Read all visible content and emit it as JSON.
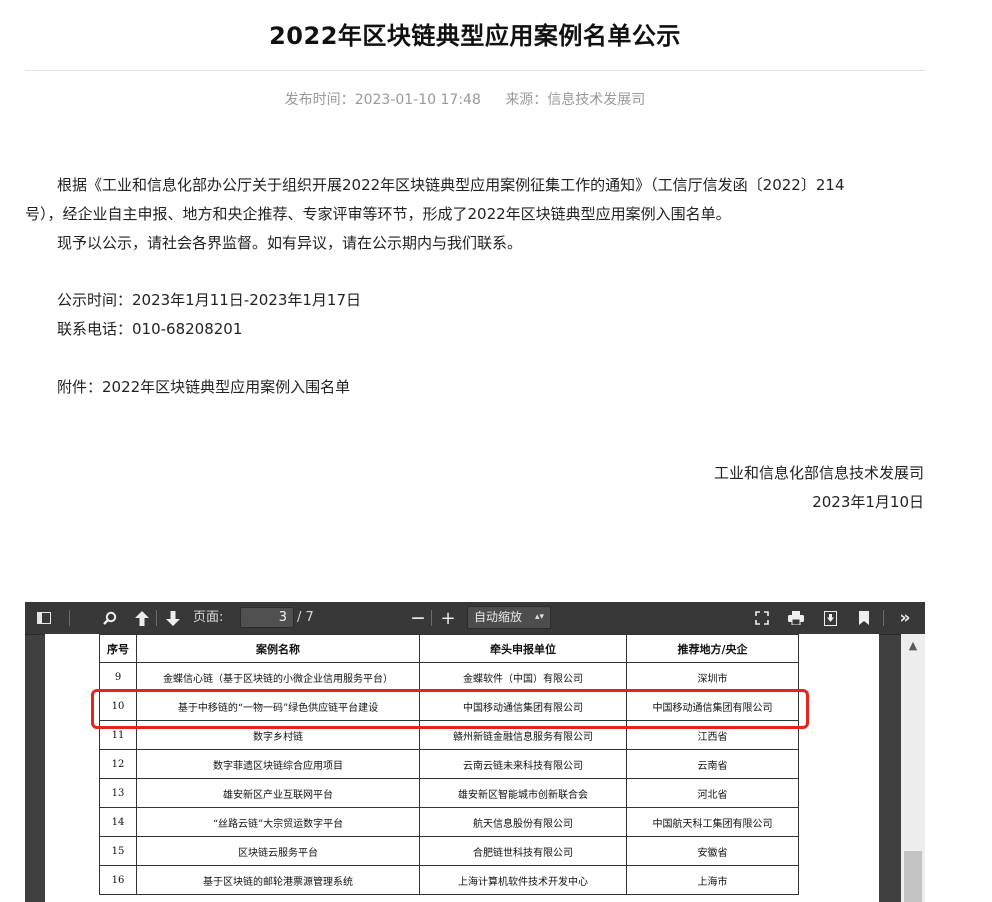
{
  "article": {
    "title": "2022年区块链典型应用案例名单公示",
    "publish_label": "发布时间：",
    "publish_time": "2023-01-10 17:48",
    "source_label": "来源：",
    "source": "信息技术发展司",
    "body_line1": "根据《工业和信息化部办公厅关于组织开展2022年区块链典型应用案例征集工作的通知》（工信厅信发函〔2022〕214",
    "body_line2": "号），经企业自主申报、地方和央企推荐、专家评审等环节，形成了2022年区块链典型应用案例入围名单。",
    "body_line3": "现予以公示，请社会各界监督。如有异议，请在公示期内与我们联系。",
    "period": "公示时间：2023年1月11日-2023年1月17日",
    "phone": "联系电话：010-68208201",
    "attachment": "附件：2022年区块链典型应用案例入围名单",
    "signature_org": "工业和信息化部信息技术发展司",
    "signature_date": "2023年1月10日"
  },
  "viewer": {
    "page_label": "页面:",
    "page_current": "3",
    "page_total": "/ 7",
    "zoom": "自动缩放",
    "zoom_out": "—",
    "zoom_in": "+"
  },
  "table": {
    "headers": [
      "序号",
      "案例名称",
      "牵头申报单位",
      "推荐地方/央企"
    ],
    "rows": [
      [
        "9",
        "金蝶信心链（基于区块链的小微企业信用服务平台）",
        "金蝶软件（中国）有限公司",
        "深圳市"
      ],
      [
        "10",
        "基于中移链的“一物一码”绿色供应链平台建设",
        "中国移动通信集团有限公司",
        "中国移动通信集团有限公司"
      ],
      [
        "11",
        "数字乡村链",
        "赣州新链金融信息服务有限公司",
        "江西省"
      ],
      [
        "12",
        "数字菲遗区块链综合应用项目",
        "云南云链未来科技有限公司",
        "云南省"
      ],
      [
        "13",
        "雄安新区产业互联网平台",
        "雄安新区智能城市创新联合会",
        "河北省"
      ],
      [
        "14",
        "“丝路云链”大宗贸运数字平台",
        "航天信息股份有限公司",
        "中国航天科工集团有限公司"
      ],
      [
        "15",
        "区块链云服务平台",
        "合肥链世科技有限公司",
        "安徽省"
      ],
      [
        "16",
        "基于区块链的邮轮港票源管理系统",
        "上海计算机软件技术开发中心",
        "上海市"
      ]
    ]
  },
  "colors": {
    "highlight": "#e8231b",
    "toolbar": "#383838"
  }
}
